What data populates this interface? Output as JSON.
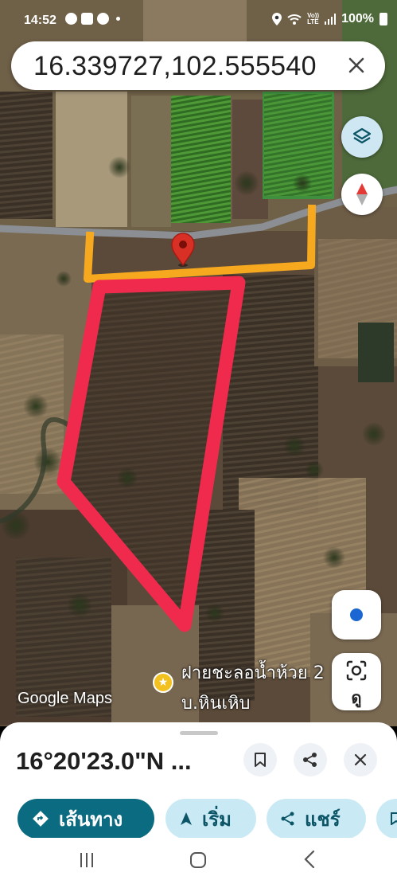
{
  "status_bar": {
    "time": "14:52",
    "battery": "100%",
    "network_label_top": "Vo))",
    "network_label_bottom": "LTE"
  },
  "search": {
    "query": "16.339727,102.555540"
  },
  "map": {
    "type": "satellite",
    "watermark": "Google Maps",
    "poi_label_line1": "ฝายชะลอน้ำห้วย 2",
    "poi_label_line2": "บ.หินเหิบ",
    "lens_label": "ดู",
    "colors": {
      "pin": "#d93025",
      "outline_red": "#f02a4d",
      "outline_orange": "#f6a81f",
      "road": "#8b8f93"
    }
  },
  "place": {
    "title": "16°20'23.0\"N ..."
  },
  "actions": {
    "directions": "เส้นทาง",
    "start": "เริ่ม",
    "share": "แชร์"
  },
  "icons": {
    "layers": "layers-icon",
    "compass": "compass-icon",
    "my_location": "my-location-icon",
    "lens": "lens-icon",
    "save": "bookmark-icon",
    "share": "share-icon",
    "close": "close-icon"
  }
}
